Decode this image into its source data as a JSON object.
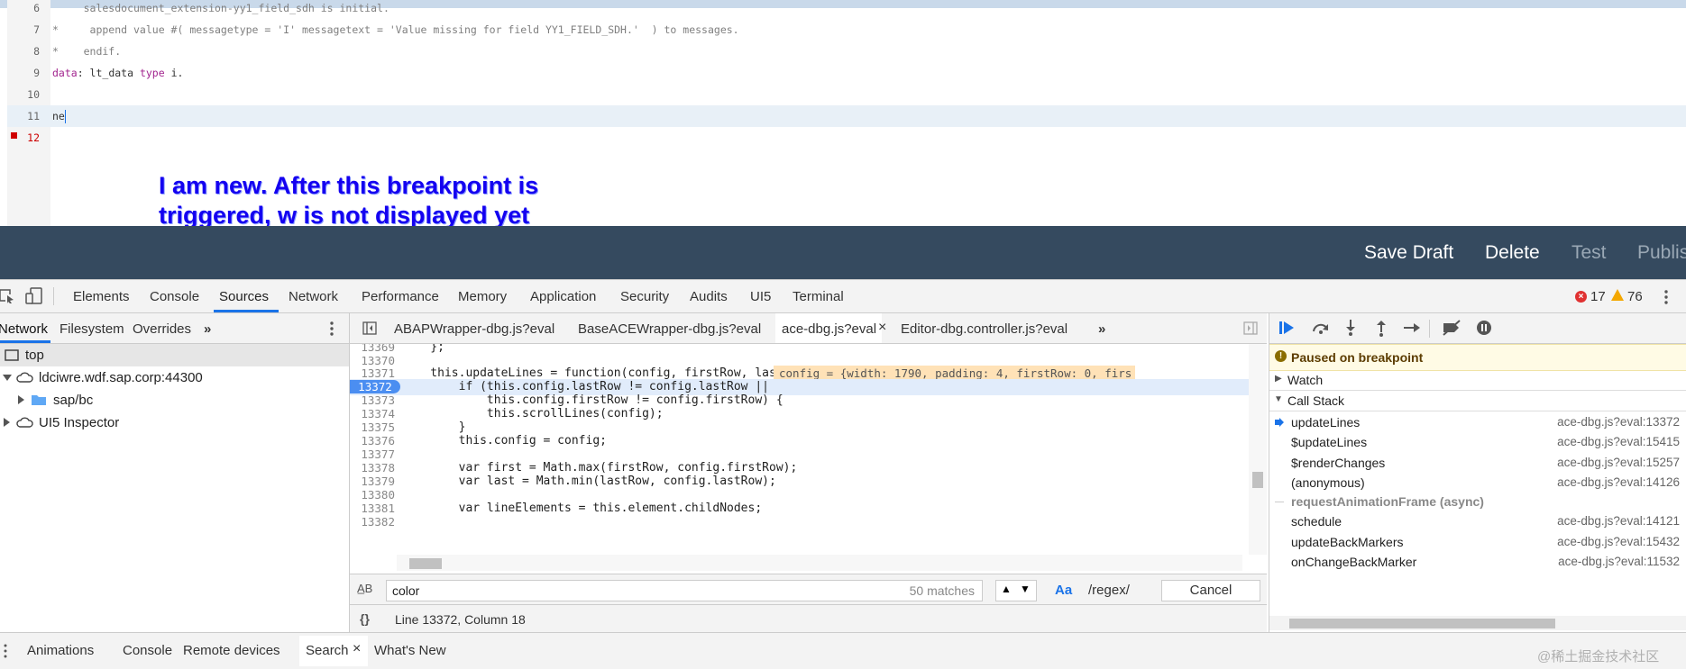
{
  "editor": {
    "lines": [
      {
        "num": "6",
        "text": "     salesdocument_extension-yy1_field_sdh is initial."
      },
      {
        "num": "7",
        "text": "*     append value #( messagetype = 'I' messagetext = 'Value missing for field YY1_FIELD_SDH.'  ) to messages."
      },
      {
        "num": "8",
        "text": "*    endif."
      },
      {
        "num": "9",
        "keyword1": "data",
        "middle": ": lt_data ",
        "keyword2": "type",
        "end": " i."
      },
      {
        "num": "10",
        "text": ""
      },
      {
        "num": "11",
        "text": "ne"
      },
      {
        "num": "12",
        "text": ""
      }
    ],
    "annotation_line1": "I am new. After this breakpoint is",
    "annotation_line2": "triggered, w is not displayed yet"
  },
  "app_toolbar": {
    "save_draft": "Save Draft",
    "delete": "Delete",
    "test": "Test",
    "publish": "Publis"
  },
  "devtools": {
    "tabs": [
      "Elements",
      "Console",
      "Sources",
      "Network",
      "Performance",
      "Memory",
      "Application",
      "Security",
      "Audits",
      "UI5",
      "Terminal"
    ],
    "error_count": "17",
    "warning_count": "76",
    "navigator": {
      "subtabs": [
        "Network",
        "Filesystem",
        "Overrides"
      ],
      "tree": [
        "top",
        "ldciwre.wdf.sap.corp:44300",
        "sap/bc",
        "UI5 Inspector"
      ]
    },
    "file_tabs": [
      "ABAPWrapper-dbg.js?eval",
      "BaseACEWrapper-dbg.js?eval",
      "ace-dbg.js?eval",
      "Editor-dbg.controller.js?eval"
    ],
    "code_lines": [
      {
        "num": "13369",
        "code": "    };"
      },
      {
        "num": "13370",
        "code": ""
      },
      {
        "num": "13371",
        "code": "    this.updateLines = function(config, firstRow, lastRow) {"
      },
      {
        "num": "13372",
        "code": "        if (this.config.lastRow != config.lastRow ||"
      },
      {
        "num": "13373",
        "code": "            this.config.firstRow != config.firstRow) {"
      },
      {
        "num": "13374",
        "code": "            this.scrollLines(config);"
      },
      {
        "num": "13375",
        "code": "        }"
      },
      {
        "num": "13376",
        "code": "        this.config = config;"
      },
      {
        "num": "13377",
        "code": ""
      },
      {
        "num": "13378",
        "code": "        var first = Math.max(firstRow, config.firstRow);"
      },
      {
        "num": "13379",
        "code": "        var last = Math.min(lastRow, config.lastRow);"
      },
      {
        "num": "13380",
        "code": ""
      },
      {
        "num": "13381",
        "code": "        var lineElements = this.element.childNodes;"
      },
      {
        "num": "13382",
        "code": ""
      }
    ],
    "inline_value": "config = {width: 1790, padding: 4, firstRow: 0, firs",
    "search": {
      "query": "color",
      "matches": "50 matches",
      "case_label": "Aa",
      "regex_label": "/regex/",
      "cancel": "Cancel"
    },
    "status": "Line 13372, Column 18",
    "debugger": {
      "paused": "Paused on breakpoint",
      "watch": "Watch",
      "call_stack": "Call Stack",
      "frames": [
        {
          "fn": "updateLines",
          "loc": "ace-dbg.js?eval:13372"
        },
        {
          "fn": "$updateLines",
          "loc": "ace-dbg.js?eval:15415"
        },
        {
          "fn": "$renderChanges",
          "loc": "ace-dbg.js?eval:15257"
        },
        {
          "fn": "(anonymous)",
          "loc": "ace-dbg.js?eval:14126"
        },
        {
          "fn": "requestAnimationFrame (async)",
          "loc": ""
        },
        {
          "fn": "schedule",
          "loc": "ace-dbg.js?eval:14121"
        },
        {
          "fn": "updateBackMarkers",
          "loc": "ace-dbg.js?eval:15432"
        },
        {
          "fn": "onChangeBackMarker",
          "loc": "ace-dbg.js?eval:11532"
        }
      ]
    },
    "drawer_tabs": [
      "Animations",
      "Console",
      "Remote devices",
      "Search",
      "What's New"
    ],
    "watermark": "@稀土掘金技术社区"
  }
}
